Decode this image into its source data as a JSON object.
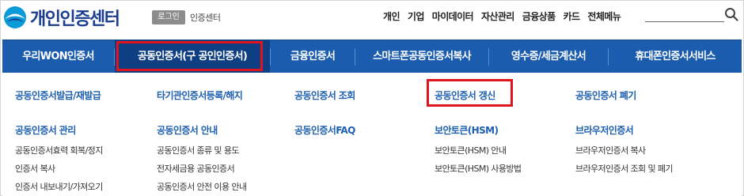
{
  "header": {
    "logo_text": "개인인증센터",
    "login_label": "로그인",
    "site_label": "인증센터",
    "util_nav": [
      "개인",
      "기업",
      "마이데이터",
      "자산관리",
      "금융상품",
      "카드",
      "전체메뉴"
    ]
  },
  "tabs": [
    {
      "label": "우리WON인증서"
    },
    {
      "label": "공동인증서(구 공인인증서)"
    },
    {
      "label": "금융인증서"
    },
    {
      "label": "스마트폰공동인증서복사"
    },
    {
      "label": "영수증/세금계산서"
    },
    {
      "label": "휴대폰인증서서비스"
    }
  ],
  "menu": {
    "row1": [
      "공동인증서발급/재발급",
      "타기관인증서등록/해지",
      "공동인증서 조회",
      "공동인증서 갱신",
      "공동인증서 폐기"
    ],
    "row2": [
      {
        "title": "공동인증서 관리",
        "items": [
          "공동인증서효력 회복/정지",
          "인증서 복사",
          "인증서 내보내기/가져오기"
        ]
      },
      {
        "title": "공동인증서 안내",
        "items": [
          "공동인증서 종류 및 용도",
          "전자세금용 공동인증서",
          "공동인증서 안전 이용 안내"
        ]
      },
      {
        "title": "공동인증서FAQ",
        "items": []
      },
      {
        "title": "보안토큰(HSM)",
        "items": [
          "보안토큰(HSM) 안내",
          "보안토큰(HSM) 사용방법"
        ]
      },
      {
        "title": "브라우저인증서",
        "items": [
          "브라우저인증서 복사",
          "브라우저인증서 조회 및 폐기"
        ]
      }
    ]
  },
  "colors": {
    "brand_blue": "#1b5cae",
    "active_tab": "#0f3f83",
    "highlight_red": "#e0141e",
    "link_blue": "#1d5fb0"
  }
}
